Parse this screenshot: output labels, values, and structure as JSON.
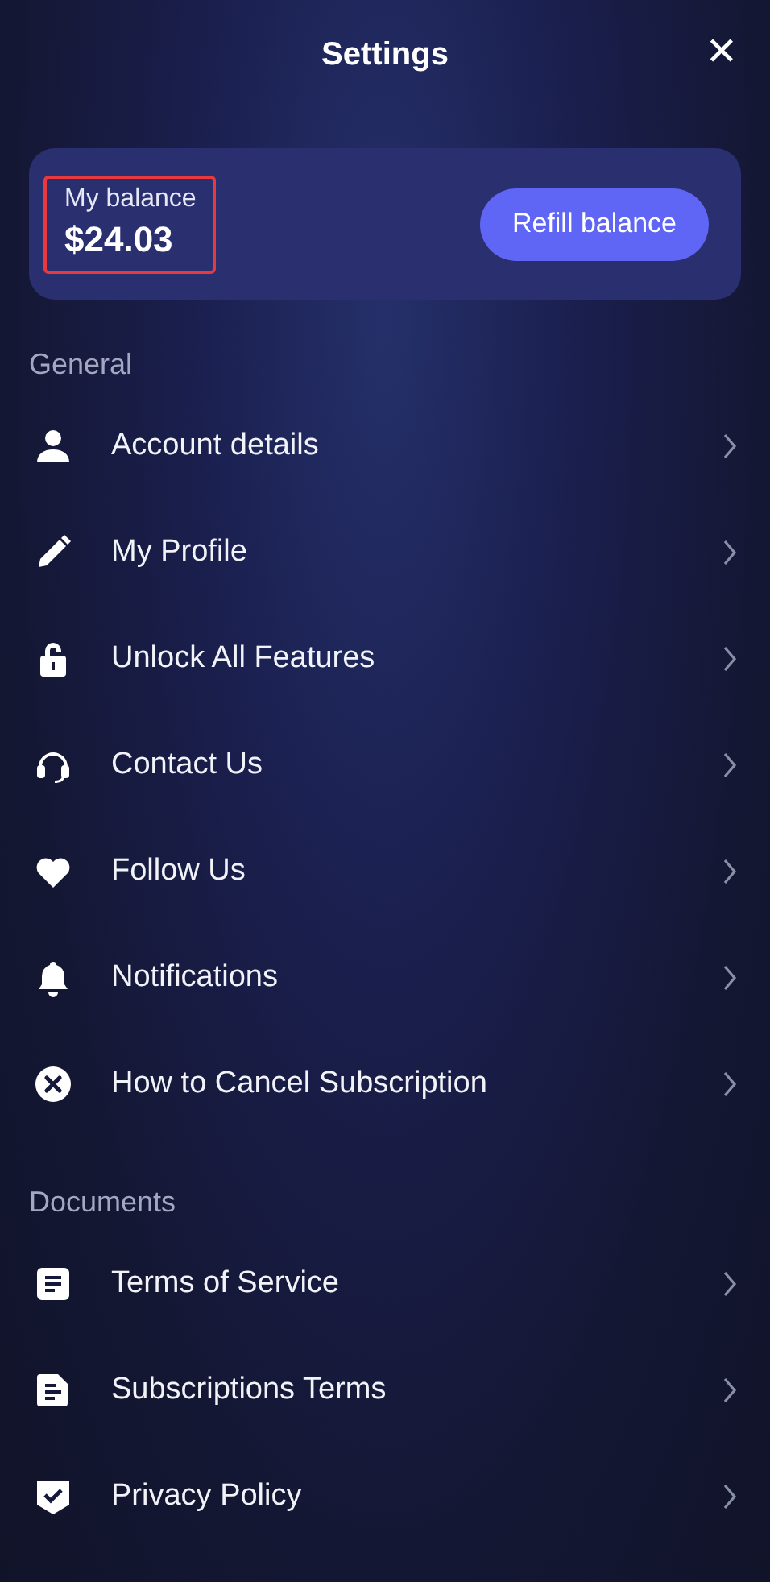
{
  "header": {
    "title": "Settings",
    "close": "✕"
  },
  "balance": {
    "label": "My balance",
    "amount": "$24.03",
    "highlighted": true,
    "button": "Refill balance"
  },
  "sections": [
    {
      "title": "General",
      "items": [
        {
          "label": "Account details"
        },
        {
          "label": "My Profile"
        },
        {
          "label": "Unlock All Features"
        },
        {
          "label": "Contact Us"
        },
        {
          "label": "Follow Us"
        },
        {
          "label": "Notifications"
        },
        {
          "label": "How to Cancel Subscription"
        }
      ]
    },
    {
      "title": "Documents",
      "items": [
        {
          "label": "Terms of Service"
        },
        {
          "label": "Subscriptions Terms"
        },
        {
          "label": "Privacy Policy"
        }
      ]
    }
  ]
}
